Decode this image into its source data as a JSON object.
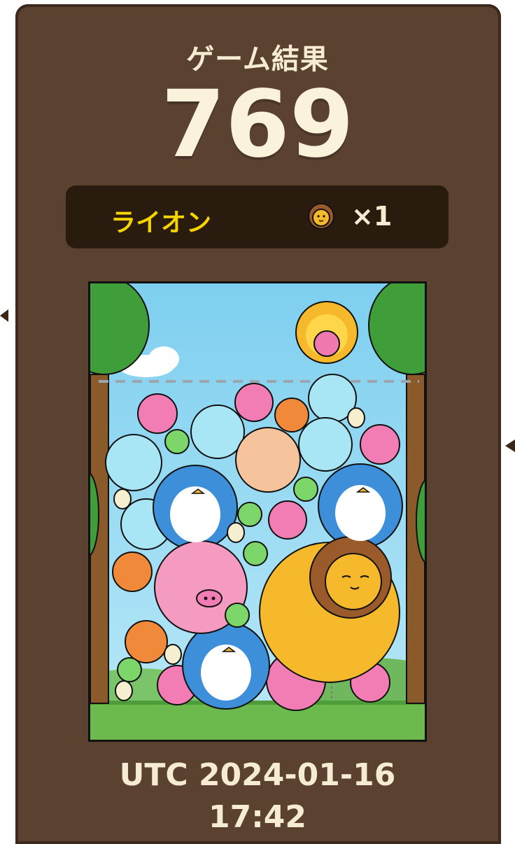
{
  "header": {
    "title": "ゲーム結果",
    "score": "769"
  },
  "result": {
    "animal_name": "ライオン",
    "animal_icon": "lion-icon",
    "count": "×1"
  },
  "board": {
    "balls": [
      "pig",
      "pig",
      "cat",
      "cat",
      "cat",
      "cat",
      "hamster",
      "penguin",
      "penguin",
      "penguin",
      "lion",
      "sun-ball",
      "elephant",
      "tiger",
      "chameleon",
      "egg"
    ]
  },
  "footer": {
    "date": "UTC 2024-01-16",
    "time": "17:42"
  },
  "colors": {
    "panel": "#5a4130",
    "bar": "#2a1b0f",
    "accent": "#f5d400",
    "text": "#f6ecd3"
  }
}
